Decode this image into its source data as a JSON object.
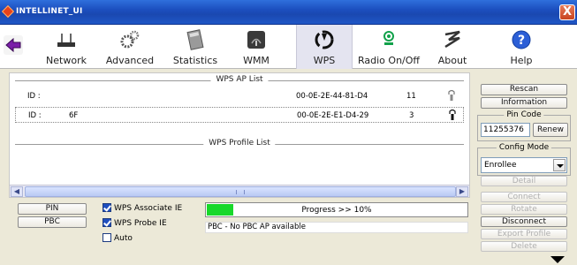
{
  "window": {
    "title": "INTELLINET_UI",
    "close_label": "X"
  },
  "toolbar": {
    "items": [
      {
        "label": "Network",
        "icon": "network-icon"
      },
      {
        "label": "Advanced",
        "icon": "gears-icon"
      },
      {
        "label": "Statistics",
        "icon": "calculator-icon"
      },
      {
        "label": "WMM",
        "icon": "wmm-icon"
      },
      {
        "label": "WPS",
        "icon": "wps-icon"
      },
      {
        "label": "Radio On/Off",
        "icon": "radio-icon"
      },
      {
        "label": "About",
        "icon": "about-icon"
      },
      {
        "label": "Help",
        "icon": "help-icon"
      }
    ],
    "active": "WPS"
  },
  "wps_ap_list": {
    "caption": "WPS AP List",
    "rows": [
      {
        "id_label": "ID :",
        "ssid": "",
        "mac": "00-0E-2E-44-81-D4",
        "channel": "11"
      },
      {
        "id_label": "ID :",
        "ssid": "6F",
        "mac": "00-0E-2E-E1-D4-29",
        "channel": "3"
      }
    ]
  },
  "wps_profile_list": {
    "caption": "WPS Profile List"
  },
  "controls": {
    "pin_button": "PIN",
    "pbc_button": "PBC",
    "wps_associate_ie": {
      "label": "WPS Associate IE",
      "checked": true
    },
    "wps_probe_ie": {
      "label": "WPS Probe IE",
      "checked": true
    },
    "auto": {
      "label": "Auto",
      "checked": false
    },
    "progress_text": "Progress >> 10%",
    "progress_value": 0.1,
    "status": "PBC - No PBC AP available"
  },
  "right_panel": {
    "rescan": "Rescan",
    "information": "Information",
    "pin_code_caption": "Pin Code",
    "pin_code_value": "11255376",
    "renew": "Renew",
    "config_mode_caption": "Config Mode",
    "config_mode_value": "Enrollee",
    "detail": "Detail",
    "connect": "Connect",
    "rotate": "Rotate",
    "disconnect": "Disconnect",
    "export_profile": "Export Profile",
    "delete": "Delete"
  },
  "colors": {
    "progress": "#18d82a",
    "titlebar": "#1c4fbf"
  }
}
